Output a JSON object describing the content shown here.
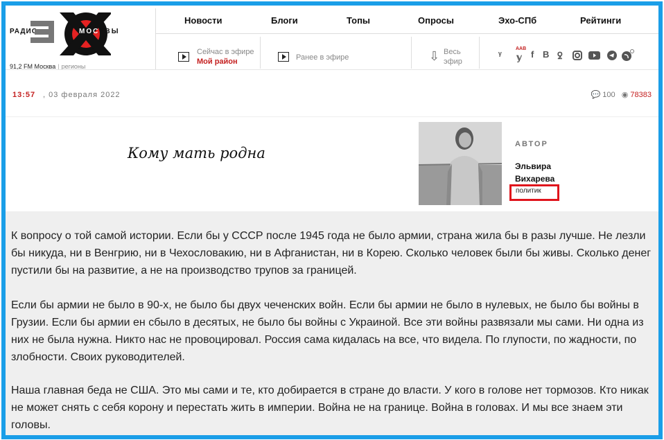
{
  "header": {
    "logo": {
      "radio": "РАДИО",
      "moskvy": "МОСКВЫ",
      "frequency": "91,2 FM Москва",
      "separator": "|",
      "regions": "регионы"
    },
    "nav": [
      "Новости",
      "Блоги",
      "Топы",
      "Опросы",
      "Эхо-СПб",
      "Рейтинги"
    ],
    "live_label": "Сейчас в эфире",
    "live_show": "Мой район",
    "earlier_label": "Ранее в эфире",
    "all_air_line1": "Весь",
    "all_air_line2": "эфир",
    "aab_badge": "AAB",
    "social_icons": [
      "yandex-zen-icon",
      "twitter-icon",
      "facebook-icon",
      "vk-icon",
      "odnoklassniki-icon",
      "instagram-icon",
      "youtube-icon",
      "telegram-icon",
      "rss-icon"
    ]
  },
  "meta": {
    "time": "13:57",
    "date": ", 03 февраля 2022",
    "comments": "100",
    "views": "78383"
  },
  "article": {
    "title": "Кому мать родна",
    "author_label": "АВТОР",
    "author_name": "Эльвира Вихарева",
    "author_tag": "политик",
    "paragraphs": [
      "К вопросу о той самой истории. Если бы у СССР после 1945 года не было армии, страна жила бы в разы лучше. Не лезли бы никуда, ни в Венгрию, ни в Чехословакию, ни в Афганистан, ни в Корею. Сколько человек были бы живы. Сколько денег пустили бы на развитие, а не на производство трупов за границей.",
      "Если бы армии не было в 90-х, не было бы двух чеченских войн. Если бы армии не было в нулевых, не было бы войны в Грузии. Если бы армии ен сбыло в десятых, не было бы войны с Украиной. Все эти войны развязали мы сами. Ни одна из них не была нужна. Никто нас не провоцировал. Россия сама кидалась на все, что видела. По глупости, по жадности, по злобности. Своих руководителей.",
      "Наша главная беда не США. Это мы сами и те, кто добирается в стране до власти. У кого в голове нет тормозов. Кто никак не может снять с себя корону и перестать жить в империи. Война не на границе. Война в головах. И мы все знаем эти головы."
    ]
  },
  "colors": {
    "frame": "#1a9ee8",
    "accent_red": "#c42020",
    "highlight_box": "#e0141c",
    "article_bg": "#efefef"
  }
}
